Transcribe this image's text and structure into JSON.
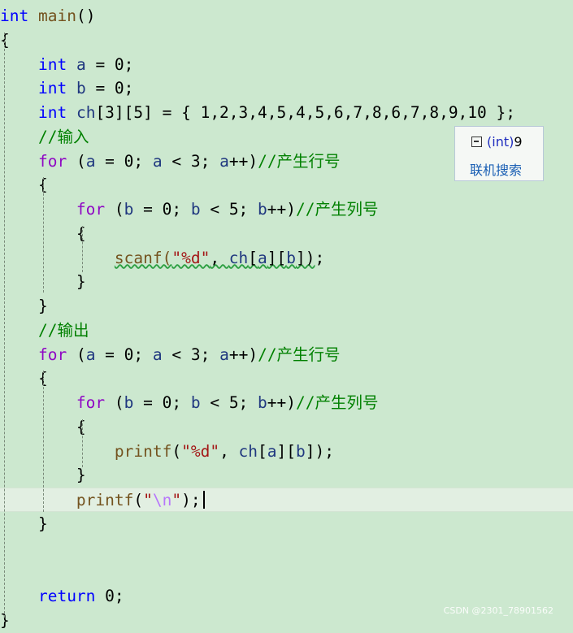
{
  "editor": {
    "lines": [
      [
        {
          "t": "int",
          "c": "kw"
        },
        {
          "t": " "
        },
        {
          "t": "main",
          "c": "fn"
        },
        {
          "t": "()"
        }
      ],
      [
        {
          "t": "{"
        }
      ],
      [
        {
          "t": "    "
        },
        {
          "t": "int",
          "c": "kw"
        },
        {
          "t": " "
        },
        {
          "t": "a",
          "c": "id"
        },
        {
          "t": " = 0;"
        }
      ],
      [
        {
          "t": "    "
        },
        {
          "t": "int",
          "c": "kw"
        },
        {
          "t": " "
        },
        {
          "t": "b",
          "c": "id"
        },
        {
          "t": " = 0;"
        }
      ],
      [
        {
          "t": "    "
        },
        {
          "t": "int",
          "c": "kw"
        },
        {
          "t": " "
        },
        {
          "t": "ch",
          "c": "id"
        },
        {
          "t": "[3][5] = { 1,2,3,4,5,4,5,6,7,8,6,7,8,9,10 };"
        }
      ],
      [
        {
          "t": "    "
        },
        {
          "t": "//输入",
          "c": "cm"
        }
      ],
      [
        {
          "t": "    "
        },
        {
          "t": "for",
          "c": "ctrl"
        },
        {
          "t": " ("
        },
        {
          "t": "a",
          "c": "id"
        },
        {
          "t": " = 0; "
        },
        {
          "t": "a",
          "c": "id"
        },
        {
          "t": " < 3; "
        },
        {
          "t": "a",
          "c": "id"
        },
        {
          "t": "++)"
        },
        {
          "t": "//产生行号",
          "c": "cm"
        }
      ],
      [
        {
          "t": "    {"
        }
      ],
      [
        {
          "t": "        "
        },
        {
          "t": "for",
          "c": "ctrl"
        },
        {
          "t": " ("
        },
        {
          "t": "b",
          "c": "id"
        },
        {
          "t": " = 0; "
        },
        {
          "t": "b",
          "c": "id"
        },
        {
          "t": " < 5; "
        },
        {
          "t": "b",
          "c": "id"
        },
        {
          "t": "++)"
        },
        {
          "t": "//产生列号",
          "c": "cm"
        }
      ],
      [
        {
          "t": "        {"
        }
      ],
      [
        {
          "t": "            "
        },
        {
          "t": "scanf(",
          "c": "fn sq"
        },
        {
          "t": "\"%d\"",
          "c": "str sq"
        },
        {
          "t": ", ",
          "c": "sq"
        },
        {
          "t": "ch",
          "c": "id sq"
        },
        {
          "t": "[",
          "c": "sq"
        },
        {
          "t": "a",
          "c": "id sq"
        },
        {
          "t": "][",
          "c": "sq"
        },
        {
          "t": "b",
          "c": "id sq"
        },
        {
          "t": "])",
          "c": "sq"
        },
        {
          "t": ";"
        }
      ],
      [
        {
          "t": "        }"
        }
      ],
      [
        {
          "t": "    }"
        }
      ],
      [
        {
          "t": "    "
        },
        {
          "t": "//输出",
          "c": "cm"
        }
      ],
      [
        {
          "t": "    "
        },
        {
          "t": "for",
          "c": "ctrl"
        },
        {
          "t": " ("
        },
        {
          "t": "a",
          "c": "id"
        },
        {
          "t": " = 0; "
        },
        {
          "t": "a",
          "c": "id"
        },
        {
          "t": " < 3; "
        },
        {
          "t": "a",
          "c": "id"
        },
        {
          "t": "++)"
        },
        {
          "t": "//产生行号",
          "c": "cm"
        }
      ],
      [
        {
          "t": "    {"
        }
      ],
      [
        {
          "t": "        "
        },
        {
          "t": "for",
          "c": "ctrl"
        },
        {
          "t": " ("
        },
        {
          "t": "b",
          "c": "id"
        },
        {
          "t": " = 0; "
        },
        {
          "t": "b",
          "c": "id"
        },
        {
          "t": " < 5; "
        },
        {
          "t": "b",
          "c": "id"
        },
        {
          "t": "++)"
        },
        {
          "t": "//产生列号",
          "c": "cm"
        }
      ],
      [
        {
          "t": "        {"
        }
      ],
      [
        {
          "t": "            "
        },
        {
          "t": "printf",
          "c": "fn"
        },
        {
          "t": "("
        },
        {
          "t": "\"%d\"",
          "c": "str"
        },
        {
          "t": ", "
        },
        {
          "t": "ch",
          "c": "id"
        },
        {
          "t": "["
        },
        {
          "t": "a",
          "c": "id"
        },
        {
          "t": "]["
        },
        {
          "t": "b",
          "c": "id"
        },
        {
          "t": "]);"
        }
      ],
      [
        {
          "t": "        }"
        }
      ],
      [
        {
          "t": "        "
        },
        {
          "t": "printf",
          "c": "fn"
        },
        {
          "t": "("
        },
        {
          "t": "\"",
          "c": "str"
        },
        {
          "t": "\\n",
          "c": "esc"
        },
        {
          "t": "\"",
          "c": "str"
        },
        {
          "t": ");"
        }
      ],
      [
        {
          "t": "    }"
        }
      ],
      [],
      [],
      [
        {
          "t": "    "
        },
        {
          "t": "return",
          "c": "kw"
        },
        {
          "t": " 0;"
        }
      ],
      [
        {
          "t": "}"
        }
      ]
    ]
  },
  "tooltip": {
    "type_text": "(int)",
    "value_text": "9",
    "search_link": "联机搜索",
    "icon": "local-variable-icon"
  },
  "watermark": "CSDN @2301_78901562"
}
